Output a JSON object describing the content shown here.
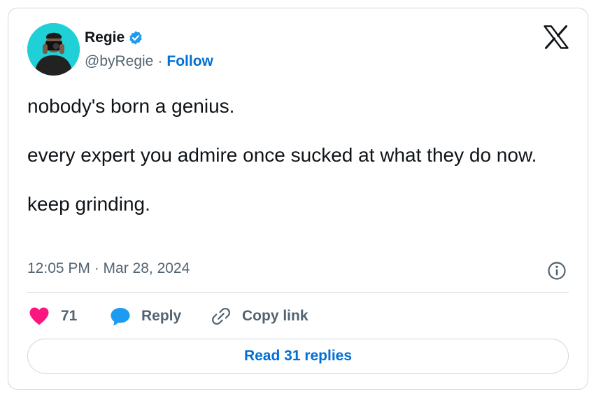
{
  "author": {
    "display_name": "Regie",
    "handle": "@byRegie",
    "separator": "·",
    "follow_label": "Follow",
    "verified": true
  },
  "tweet": {
    "lines": [
      "nobody's born a genius.",
      "every expert you admire once sucked at what they do now.",
      "keep grinding."
    ],
    "timestamp": "12:05 PM · Mar 28, 2024"
  },
  "actions": {
    "like_count": "71",
    "reply_label": "Reply",
    "copy_link_label": "Copy link"
  },
  "read_replies_label": "Read 31 replies",
  "icons": {
    "platform": "x-logo-icon",
    "verified": "verified-badge-icon",
    "info": "info-icon",
    "like": "heart-icon",
    "reply": "speech-bubble-icon",
    "copy": "link-icon"
  },
  "colors": {
    "text": "#0f1419",
    "muted": "#536471",
    "accent": "#006fd6",
    "verified": "#1d9bf0",
    "like": "#f91880",
    "reply": "#1d9bf0",
    "border": "#cfd9de",
    "avatar_bg": "#1fd1d6"
  }
}
